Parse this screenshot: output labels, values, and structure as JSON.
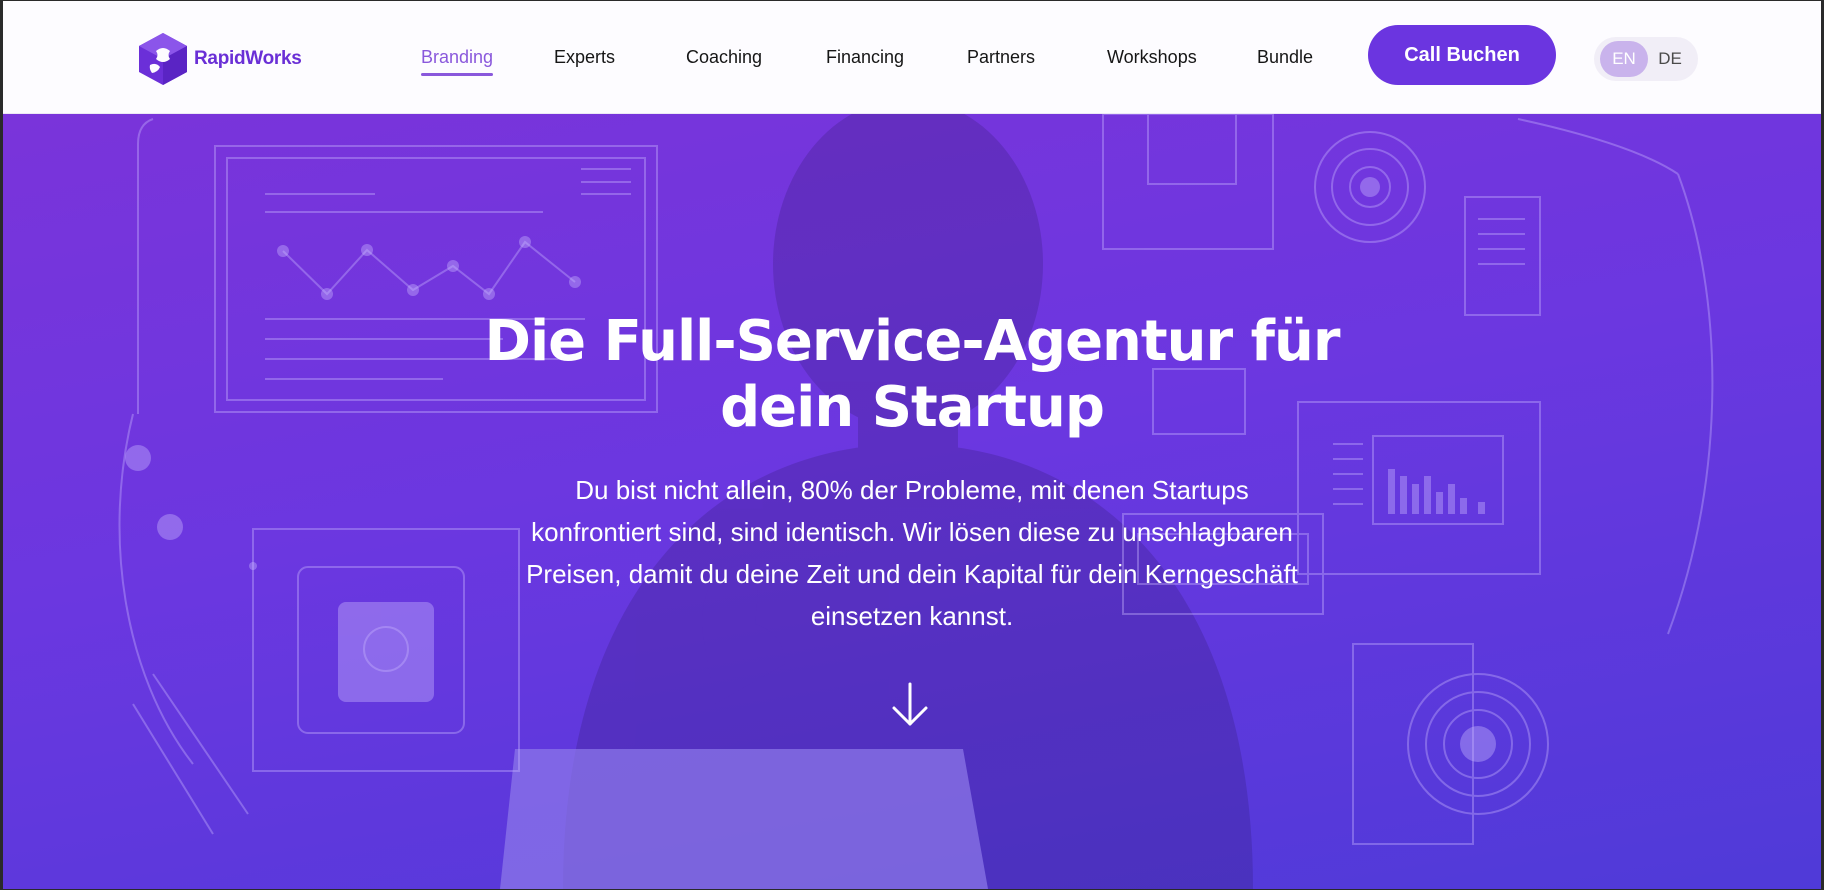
{
  "brand": {
    "name": "RapidWorks",
    "logo_icon": "puzzle-cube-logo-icon",
    "accent_color": "#6b35e0"
  },
  "nav": {
    "items": [
      {
        "label": "Branding",
        "active": true
      },
      {
        "label": "Experts",
        "active": false
      },
      {
        "label": "Coaching",
        "active": false
      },
      {
        "label": "Financing",
        "active": false
      },
      {
        "label": "Partners",
        "active": false
      },
      {
        "label": "Workshops",
        "active": false
      },
      {
        "label": "Bundle",
        "active": false
      }
    ],
    "cta_label": "Call Buchen",
    "languages": {
      "en": "EN",
      "de": "DE",
      "selected": "EN"
    }
  },
  "hero": {
    "title": "Die Full-Service-Agentur für dein Startup",
    "text": "Du bist nicht allein, 80% der Probleme, mit denen Startups konfrontiert sind, sind identisch. Wir lösen diese zu unschlagbaren Preisen, damit du deine Zeit und dein Kapital für dein Kerngeschäft einsetzen kannst.",
    "scroll_icon": "arrow-down-icon",
    "background_color": "#6b37e0"
  }
}
